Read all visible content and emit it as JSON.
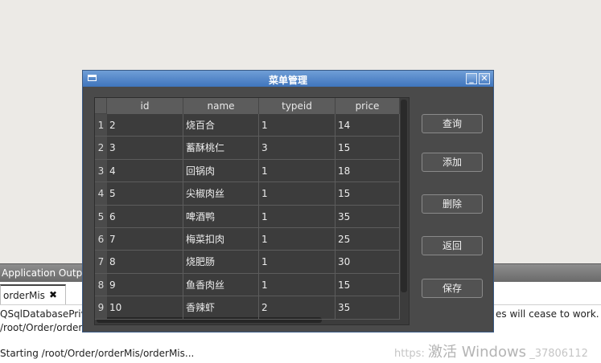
{
  "ide": {
    "panel_title": "Application Outpu",
    "tab_label": "orderMis",
    "tab_close": "✖",
    "output_lines": [
      "QSqlDatabasePriv",
      "/root/Order/order",
      "Starting /root/Order/orderMis/orderMis..."
    ],
    "output_right": "es will cease to work.",
    "watermark_prefix": "https:",
    "watermark_main": "激活 Windows",
    "watermark_suffix": "_37806112"
  },
  "dialog": {
    "title": "菜单管理",
    "minimize_label": "_",
    "close_label": "✕"
  },
  "table": {
    "columns": [
      "id",
      "name",
      "typeid",
      "price"
    ],
    "rows": [
      {
        "n": "1",
        "id": "2",
        "name": "烧百合",
        "typeid": "1",
        "price": "14"
      },
      {
        "n": "2",
        "id": "3",
        "name": "蓄酥桃仁",
        "typeid": "3",
        "price": "15"
      },
      {
        "n": "3",
        "id": "4",
        "name": "回锅肉",
        "typeid": "1",
        "price": "18"
      },
      {
        "n": "4",
        "id": "5",
        "name": "尖椒肉丝",
        "typeid": "1",
        "price": "15"
      },
      {
        "n": "5",
        "id": "6",
        "name": "啤酒鸭",
        "typeid": "1",
        "price": "35"
      },
      {
        "n": "6",
        "id": "7",
        "name": "梅菜扣肉",
        "typeid": "1",
        "price": "25"
      },
      {
        "n": "7",
        "id": "8",
        "name": "烧肥肠",
        "typeid": "1",
        "price": "30"
      },
      {
        "n": "8",
        "id": "9",
        "name": "鱼香肉丝",
        "typeid": "1",
        "price": "15"
      },
      {
        "n": "9",
        "id": "10",
        "name": "香辣虾",
        "typeid": "2",
        "price": "35"
      }
    ]
  },
  "buttons": {
    "query": "查询",
    "add": "添加",
    "delete": "删除",
    "back": "返回",
    "save": "保存"
  }
}
